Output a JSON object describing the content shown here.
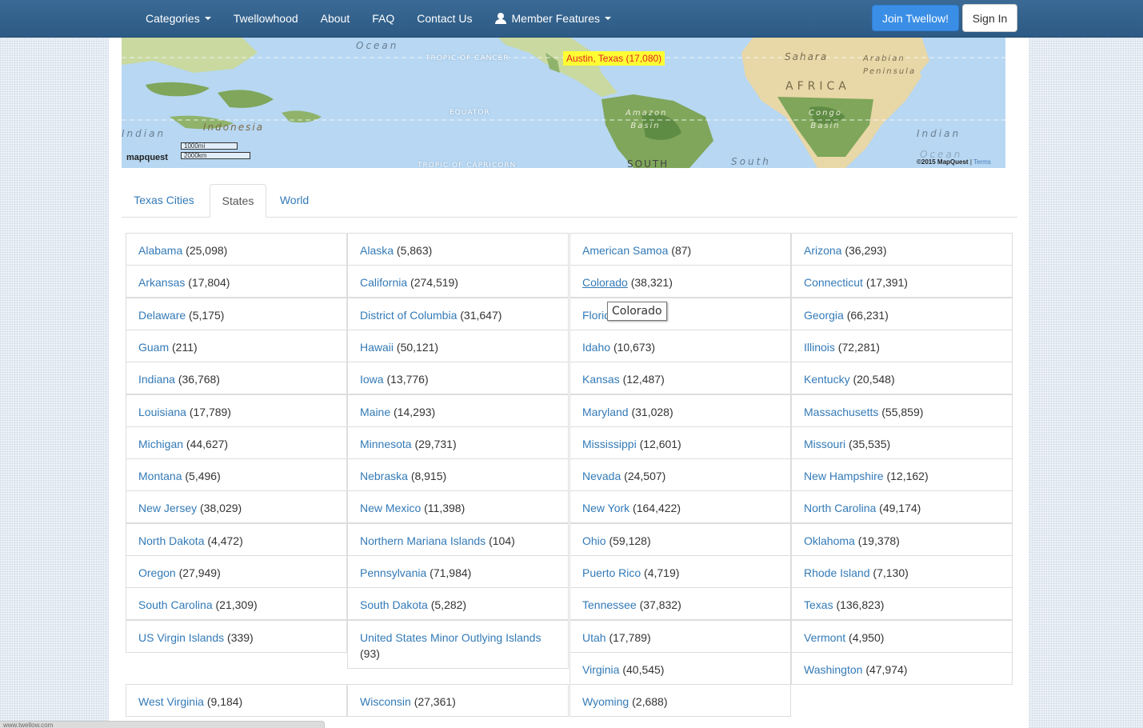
{
  "nav": {
    "links": [
      "Categories",
      "Twellowhood",
      "About",
      "FAQ",
      "Contact Us",
      "Member Features"
    ],
    "join_label": "Join Twellow!",
    "signin_label": "Sign In"
  },
  "map": {
    "ocean_labels": [
      "Ocean",
      "Indian",
      "Indian",
      "South",
      "Ocean"
    ],
    "line_labels": [
      "TROPIC OF CANCER",
      "EQUATOR",
      "TROPIC OF CAPRICORN"
    ],
    "land_labels": [
      "Indonesia",
      "Sahara",
      "Arabian Peninsula",
      "AFRICA",
      "Amazon Basin",
      "Congo Basin",
      "SOUTH"
    ],
    "marker": "Austin, Texas (17,080)",
    "scale_mi": "1000mi",
    "scale_km": "2000km",
    "provider": "mapquest",
    "copyright": "©2015 MapQuest",
    "terms": "Terms",
    "colors": {
      "ocean": "#b7d7f2",
      "land": "#c9d9a0",
      "forest": "#7fa65a",
      "desert": "#e8d7a7"
    }
  },
  "tabs": [
    {
      "label": "Texas Cities",
      "active": false
    },
    {
      "label": "States",
      "active": true
    },
    {
      "label": "World",
      "active": false
    }
  ],
  "tooltip": "Colorado",
  "states": [
    [
      {
        "name": "Alabama",
        "count": "(25,098)"
      },
      {
        "name": "Alaska",
        "count": "(5,863)"
      },
      {
        "name": "American Samoa",
        "count": "(87)"
      },
      {
        "name": "Arizona",
        "count": "(36,293)"
      }
    ],
    [
      {
        "name": "Arkansas",
        "count": "(17,804)"
      },
      {
        "name": "California",
        "count": "(274,519)"
      },
      {
        "name": "Colorado",
        "count": "(38,321)"
      },
      {
        "name": "Connecticut",
        "count": "(17,391)"
      }
    ],
    [
      {
        "name": "Delaware",
        "count": "(5,175)"
      },
      {
        "name": "District of Columbia",
        "count": "(31,647)"
      },
      {
        "name": "Florida",
        "count": ""
      },
      {
        "name": "Georgia",
        "count": "(66,231)"
      }
    ],
    [
      {
        "name": "Guam",
        "count": "(211)"
      },
      {
        "name": "Hawaii",
        "count": "(50,121)"
      },
      {
        "name": "Idaho",
        "count": "(10,673)"
      },
      {
        "name": "Illinois",
        "count": "(72,281)"
      }
    ],
    [
      {
        "name": "Indiana",
        "count": "(36,768)"
      },
      {
        "name": "Iowa",
        "count": "(13,776)"
      },
      {
        "name": "Kansas",
        "count": "(12,487)"
      },
      {
        "name": "Kentucky",
        "count": "(20,548)"
      }
    ],
    [
      {
        "name": "Louisiana",
        "count": "(17,789)"
      },
      {
        "name": "Maine",
        "count": "(14,293)"
      },
      {
        "name": "Maryland",
        "count": "(31,028)"
      },
      {
        "name": "Massachusetts",
        "count": "(55,859)"
      }
    ],
    [
      {
        "name": "Michigan",
        "count": "(44,627)"
      },
      {
        "name": "Minnesota",
        "count": "(29,731)"
      },
      {
        "name": "Mississippi",
        "count": "(12,601)"
      },
      {
        "name": "Missouri",
        "count": "(35,535)"
      }
    ],
    [
      {
        "name": "Montana",
        "count": "(5,496)"
      },
      {
        "name": "Nebraska",
        "count": "(8,915)"
      },
      {
        "name": "Nevada",
        "count": "(24,507)"
      },
      {
        "name": "New Hampshire",
        "count": "(12,162)"
      }
    ],
    [
      {
        "name": "New Jersey",
        "count": "(38,029)"
      },
      {
        "name": "New Mexico",
        "count": "(11,398)"
      },
      {
        "name": "New York",
        "count": "(164,422)"
      },
      {
        "name": "North Carolina",
        "count": "(49,174)"
      }
    ],
    [
      {
        "name": "North Dakota",
        "count": "(4,472)"
      },
      {
        "name": "Northern Mariana Islands",
        "count": "(104)"
      },
      {
        "name": "Ohio",
        "count": "(59,128)"
      },
      {
        "name": "Oklahoma",
        "count": "(19,378)"
      }
    ],
    [
      {
        "name": "Oregon",
        "count": "(27,949)"
      },
      {
        "name": "Pennsylvania",
        "count": "(71,984)"
      },
      {
        "name": "Puerto Rico",
        "count": "(4,719)"
      },
      {
        "name": "Rhode Island",
        "count": "(7,130)"
      }
    ],
    [
      {
        "name": "South Carolina",
        "count": "(21,309)"
      },
      {
        "name": "South Dakota",
        "count": "(5,282)"
      },
      {
        "name": "Tennessee",
        "count": "(37,832)"
      },
      {
        "name": "Texas",
        "count": "(136,823)"
      }
    ],
    [
      {
        "name": "US Virgin Islands",
        "count": "(339)"
      },
      {
        "name": "United States Minor Outlying Islands",
        "count": "(93)"
      },
      {
        "name": "Utah",
        "count": "(17,789)"
      },
      {
        "name": "Vermont",
        "count": "(4,950)"
      }
    ],
    [
      null,
      null,
      {
        "name": "Virginia",
        "count": "(40,545)"
      },
      {
        "name": "Washington",
        "count": "(47,974)"
      }
    ],
    [
      {
        "name": "West Virginia",
        "count": "(9,184)"
      },
      {
        "name": "Wisconsin",
        "count": "(27,361)"
      },
      {
        "name": "Wyoming",
        "count": "(2,688)"
      },
      null
    ]
  ],
  "status_bar": "www.twellow.com"
}
